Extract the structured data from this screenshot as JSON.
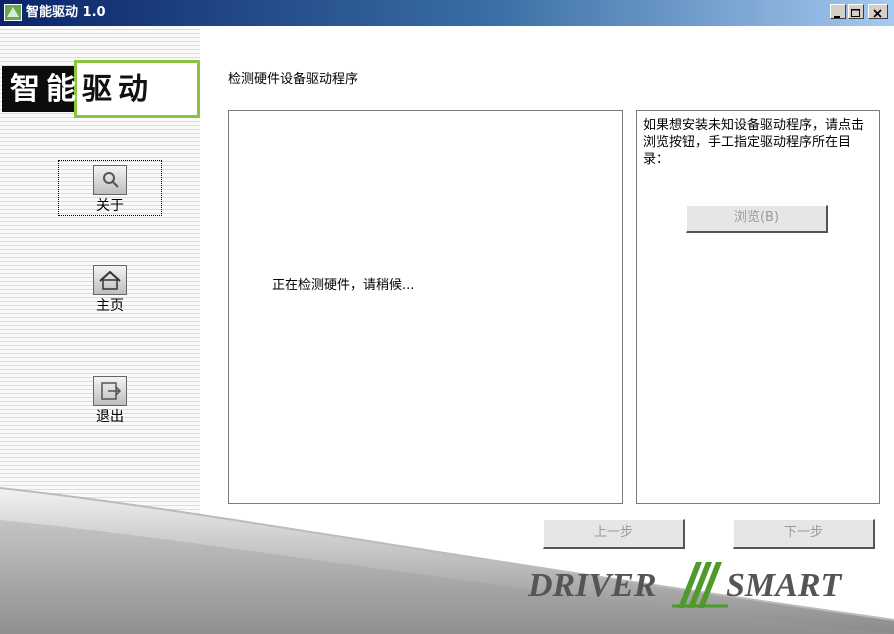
{
  "window": {
    "title": "智能驱动 1.0",
    "controls": {
      "minimize": "_",
      "maximize": "□",
      "close": "×"
    }
  },
  "sidebar": {
    "brand": {
      "part1": "智能",
      "part2": "驱动"
    },
    "items": [
      {
        "label": "关于",
        "icon": "magnifier-icon"
      },
      {
        "label": "主页",
        "icon": "home-icon"
      },
      {
        "label": "退出",
        "icon": "exit-icon"
      }
    ]
  },
  "main": {
    "status": "检测硬件设备驱动程序",
    "detect_message": "正在检测硬件，请稍候...",
    "hint": "如果想安装未知设备驱动程序，请点击浏览按钮，手工指定驱动程序所在目录：",
    "browse_label": "浏览(B)"
  },
  "buttons": {
    "prev": "上一步",
    "next": "下一步"
  },
  "logo": {
    "left": "DRIVER",
    "right": "SMART"
  },
  "colors": {
    "brand_green": "#8bc53f",
    "titlebar": "#0a246a",
    "logo_green": "#4e9a2a"
  }
}
